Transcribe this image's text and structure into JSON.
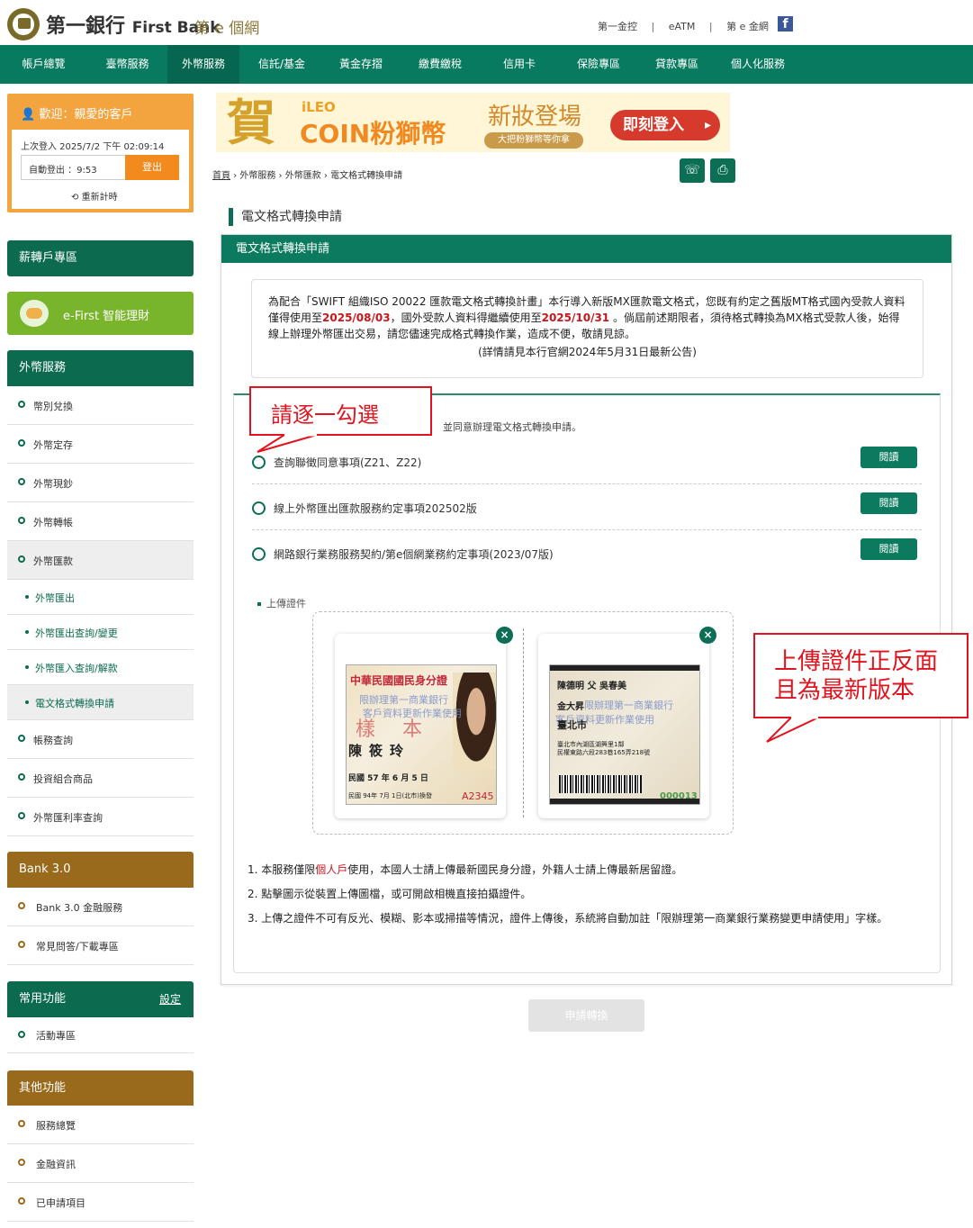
{
  "header": {
    "bank_name_cn": "第一銀行",
    "bank_name_en": "First Bank",
    "site_name": "第 e 個網",
    "top_links": [
      "第一金控",
      "eATM",
      "第 e 金網"
    ],
    "facebook": "f"
  },
  "nav": {
    "items": [
      "帳戶總覽",
      "臺幣服務",
      "外幣服務",
      "信託/基金",
      "黃金存摺",
      "繳費繳稅",
      "信用卡",
      "保險專區",
      "貸款專區",
      "個人化服務"
    ],
    "active": "外幣服務"
  },
  "welcome": {
    "greeting": "歡迎：親愛的客戶",
    "last_login": "上次登入  2025/7/2 下午 02:09:14",
    "auto_logout": "自動登出 ：9:53",
    "logout": "登出",
    "reset_timer": "重新計時"
  },
  "sidebar": {
    "salary": "薪轉戶專區",
    "efirst": "e-First 智能理財",
    "forex_head": "外幣服務",
    "forex_items": [
      "幣別兌換",
      "外幣定存",
      "外幣現鈔",
      "外幣轉帳",
      "外幣匯款"
    ],
    "remit_sub": [
      "外幣匯出",
      "外幣匯出查詢/變更",
      "外幣匯入查詢/解款",
      "電文格式轉換申請"
    ],
    "forex_more": [
      "帳務查詢",
      "投資組合商品",
      "外幣匯利率查詢"
    ],
    "bank30_head": "Bank 3.0",
    "bank30_items": [
      "Bank 3.0 金融服務",
      "常見問答/下載專區"
    ],
    "common_head": "常用功能",
    "common_setting": "設定",
    "common_items": [
      "活動專區"
    ],
    "other_head": "其他功能",
    "other_items": [
      "服務總覽",
      "金融資訊",
      "已申請項目"
    ]
  },
  "banner": {
    "he": "賀",
    "ileo": "iLEO",
    "coin": "COIN粉獅幣",
    "new": "新妝登場",
    "small": "大把粉獅幣等你拿",
    "login": "即刻登入"
  },
  "breadcrumb": {
    "home": "首頁",
    "path": "› 外幣服務 › 外幣匯款 › 電文格式轉換申請"
  },
  "tools": {
    "phone": "☏",
    "print": "⎙"
  },
  "page": {
    "title": "電文格式轉換申請",
    "panel_title": "電文格式轉換申請",
    "notice_1": "為配合「SWIFT 組織ISO 20022 匯款電文格式轉換計畫」本行導入新版MX匯款電文格式，您既有約定之舊版MT格式國內受款人資料僅得使用至",
    "notice_date1": "2025/08/03",
    "notice_2": "，國外受款人資料得繼續使用至",
    "notice_date2": "2025/10/31",
    "notice_3": " 。倘屆前述期限者，須待格式轉換為MX格式受款人後，始得線上辦理外幣匯出交易，請您儘速完成格式轉換作業，造成不便，敬請見諒。",
    "notice_center": "(詳情請見本行官網2024年5月31日最新公告)",
    "agree_text": "並同意辦理電文格式轉換申請。",
    "terms": [
      "查詢聯徵同意事項(Z21、Z22)",
      "線上外幣匯出匯款服務約定事項202502版",
      "網路銀行業務服務契約/第e個網業務約定事項(2023/07版)"
    ],
    "read_label": "閱讀",
    "upload_label": "上傳證件",
    "notes_1a": "1. 本服務僅限",
    "notes_1red": "個人戶",
    "notes_1b": "使用，本國人士請上傳最新國民身分證，外籍人士請上傳最新居留證。",
    "notes_2": "2. 點擊圖示從裝置上傳圖檔，或可開啟相機直接拍攝證件。",
    "notes_3": "3. 上傳之證件不可有反光、模糊、影本或掃描等情況，證件上傳後，系統將自動加註「限辦理第一商業銀行業務變更申請使用」字樣。",
    "apply": "申請轉換"
  },
  "id_front": {
    "title": "中華民國國民身分證",
    "watermark_1": "限辦理第一商業銀行",
    "watermark_2": "客戶資料更新作業使用",
    "sample": "樣本",
    "name": "陳筱玲",
    "dob": "民國 57 年 6 月 5 日",
    "issue": "民國 94年 7月 1日(北市)換發",
    "number": "A2345"
  },
  "id_back": {
    "line1": "陳德明    父  吳春美",
    "line2": "金大昇",
    "watermark_1": "限辦理第一商業銀行",
    "watermark_2": "客戶資料更新作業使用",
    "line3": "臺北市",
    "addr": "臺北市內湖區湖興里1鄰\n民權東路六段283巷165弄218號",
    "code": "000013"
  },
  "callouts": {
    "one": "請逐一勾選",
    "two_line1": "上傳證件正反面",
    "two_line2": "且為最新版本"
  },
  "colors": {
    "nav_green": "#087a5f",
    "sidebar_green": "#0c6b4f",
    "orange": "#f3a43e",
    "brown": "#9a6a1c",
    "callout_red": "#e0141e"
  }
}
